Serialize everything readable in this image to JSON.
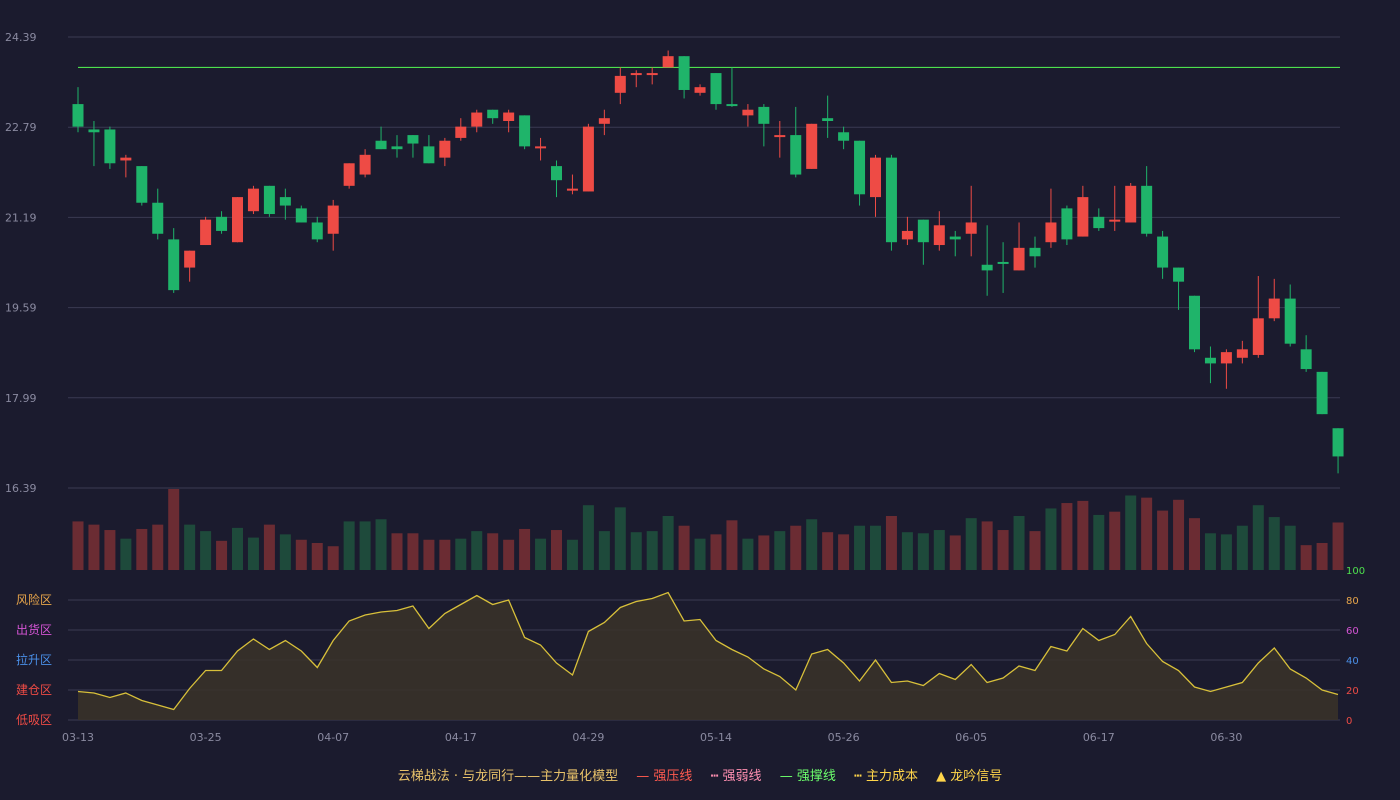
{
  "colors": {
    "background": "#1b1b2e",
    "grid": "#3b3b52",
    "axis_text": "#8a8aa0",
    "up": "#ee4b45",
    "down": "#1fb46a",
    "vol_up": "#6b2c33",
    "vol_down": "#1e4a3b",
    "resistance": "#4de04d",
    "indicator_line": "#d8c03a",
    "indicator_fill": "#3a3328",
    "zone_risk": "#e8a54a",
    "zone_sell": "#d454d4",
    "zone_rise": "#4a8fe8",
    "zone_build": "#ee4b45",
    "zone_low": "#ee4b45",
    "tick_80": "#e8a54a",
    "tick_60": "#d454d4",
    "tick_40": "#4a8fe8",
    "tick_20": "#ee4b45",
    "tick_0": "#ee4b45",
    "tick_100": "#4de04d"
  },
  "legend": {
    "title": "云梯战法 · 与龙同行——主力量化模型",
    "items": [
      {
        "symbol": "—",
        "label": "强压线"
      },
      {
        "symbol": "┅",
        "label": "强弱线"
      },
      {
        "symbol": "—",
        "label": "强撑线"
      },
      {
        "symbol": "┅",
        "label": "主力成本"
      },
      {
        "symbol": "▲",
        "label": "龙吟信号"
      }
    ]
  },
  "chart_data": [
    {
      "type": "candlestick",
      "y_ticks": [
        "24.39",
        "22.79",
        "21.19",
        "19.59",
        "17.99",
        "16.39"
      ],
      "ylim": [
        16.39,
        24.39
      ],
      "x_tick_labels": [
        {
          "index": 0,
          "label": "03-13"
        },
        {
          "index": 8,
          "label": "03-25"
        },
        {
          "index": 16,
          "label": "04-07"
        },
        {
          "index": 24,
          "label": "04-17"
        },
        {
          "index": 32,
          "label": "04-29"
        },
        {
          "index": 40,
          "label": "05-14"
        },
        {
          "index": 48,
          "label": "05-26"
        },
        {
          "index": 56,
          "label": "06-05"
        },
        {
          "index": 64,
          "label": "06-17"
        },
        {
          "index": 72,
          "label": "06-30"
        }
      ],
      "resistance_level": 23.85,
      "candles": [
        {
          "o": 22.8,
          "c": 23.2,
          "h": 23.5,
          "l": 22.7,
          "dir": "down"
        },
        {
          "o": 22.75,
          "c": 22.7,
          "h": 22.9,
          "l": 22.1,
          "dir": "down"
        },
        {
          "o": 22.75,
          "c": 22.15,
          "h": 22.8,
          "l": 22.05,
          "dir": "down"
        },
        {
          "o": 22.2,
          "c": 22.25,
          "h": 22.3,
          "l": 21.9,
          "dir": "up"
        },
        {
          "o": 22.1,
          "c": 21.45,
          "h": 22.1,
          "l": 21.4,
          "dir": "down"
        },
        {
          "o": 21.45,
          "c": 20.9,
          "h": 21.7,
          "l": 20.8,
          "dir": "down"
        },
        {
          "o": 20.8,
          "c": 19.9,
          "h": 21.0,
          "l": 19.85,
          "dir": "down"
        },
        {
          "o": 20.3,
          "c": 20.6,
          "h": 20.6,
          "l": 20.05,
          "dir": "up"
        },
        {
          "o": 20.7,
          "c": 21.15,
          "h": 21.2,
          "l": 20.7,
          "dir": "up"
        },
        {
          "o": 21.2,
          "c": 20.95,
          "h": 21.3,
          "l": 20.9,
          "dir": "down"
        },
        {
          "o": 20.75,
          "c": 21.55,
          "h": 21.55,
          "l": 20.75,
          "dir": "up"
        },
        {
          "o": 21.3,
          "c": 21.7,
          "h": 21.75,
          "l": 21.25,
          "dir": "up"
        },
        {
          "o": 21.75,
          "c": 21.25,
          "h": 21.75,
          "l": 21.2,
          "dir": "down"
        },
        {
          "o": 21.55,
          "c": 21.4,
          "h": 21.7,
          "l": 21.15,
          "dir": "down"
        },
        {
          "o": 21.35,
          "c": 21.1,
          "h": 21.4,
          "l": 21.1,
          "dir": "down"
        },
        {
          "o": 21.1,
          "c": 20.8,
          "h": 21.2,
          "l": 20.75,
          "dir": "down"
        },
        {
          "o": 20.9,
          "c": 21.4,
          "h": 21.5,
          "l": 20.6,
          "dir": "up"
        },
        {
          "o": 21.75,
          "c": 22.15,
          "h": 22.15,
          "l": 21.7,
          "dir": "up"
        },
        {
          "o": 21.95,
          "c": 22.3,
          "h": 22.4,
          "l": 21.9,
          "dir": "up"
        },
        {
          "o": 22.55,
          "c": 22.4,
          "h": 22.8,
          "l": 22.4,
          "dir": "down"
        },
        {
          "o": 22.45,
          "c": 22.4,
          "h": 22.65,
          "l": 22.25,
          "dir": "down"
        },
        {
          "o": 22.65,
          "c": 22.5,
          "h": 22.65,
          "l": 22.25,
          "dir": "down"
        },
        {
          "o": 22.45,
          "c": 22.15,
          "h": 22.65,
          "l": 22.15,
          "dir": "down"
        },
        {
          "o": 22.25,
          "c": 22.55,
          "h": 22.6,
          "l": 22.1,
          "dir": "up"
        },
        {
          "o": 22.6,
          "c": 22.8,
          "h": 22.95,
          "l": 22.55,
          "dir": "up"
        },
        {
          "o": 22.8,
          "c": 23.05,
          "h": 23.1,
          "l": 22.7,
          "dir": "up"
        },
        {
          "o": 23.1,
          "c": 22.95,
          "h": 23.1,
          "l": 22.85,
          "dir": "down"
        },
        {
          "o": 22.9,
          "c": 23.05,
          "h": 23.1,
          "l": 22.7,
          "dir": "up"
        },
        {
          "o": 23.0,
          "c": 22.45,
          "h": 23.0,
          "l": 22.4,
          "dir": "down"
        },
        {
          "o": 22.45,
          "c": 22.45,
          "h": 22.6,
          "l": 22.2,
          "dir": "up"
        },
        {
          "o": 22.1,
          "c": 21.85,
          "h": 22.2,
          "l": 21.55,
          "dir": "down"
        },
        {
          "o": 21.7,
          "c": 21.7,
          "h": 21.95,
          "l": 21.6,
          "dir": "up"
        },
        {
          "o": 21.65,
          "c": 22.8,
          "h": 22.85,
          "l": 21.65,
          "dir": "up"
        },
        {
          "o": 22.85,
          "c": 22.95,
          "h": 23.1,
          "l": 22.65,
          "dir": "up"
        },
        {
          "o": 23.4,
          "c": 23.7,
          "h": 23.85,
          "l": 23.2,
          "dir": "up"
        },
        {
          "o": 23.75,
          "c": 23.75,
          "h": 23.8,
          "l": 23.5,
          "dir": "up"
        },
        {
          "o": 23.75,
          "c": 23.75,
          "h": 23.85,
          "l": 23.55,
          "dir": "up"
        },
        {
          "o": 23.85,
          "c": 24.05,
          "h": 24.15,
          "l": 23.85,
          "dir": "up"
        },
        {
          "o": 24.05,
          "c": 23.45,
          "h": 24.05,
          "l": 23.3,
          "dir": "down"
        },
        {
          "o": 23.4,
          "c": 23.5,
          "h": 23.55,
          "l": 23.35,
          "dir": "up"
        },
        {
          "o": 23.75,
          "c": 23.2,
          "h": 23.75,
          "l": 23.1,
          "dir": "down"
        },
        {
          "o": 23.2,
          "c": 23.2,
          "h": 23.85,
          "l": 23.15,
          "dir": "down"
        },
        {
          "o": 23.0,
          "c": 23.1,
          "h": 23.2,
          "l": 22.8,
          "dir": "up"
        },
        {
          "o": 23.15,
          "c": 22.85,
          "h": 23.2,
          "l": 22.45,
          "dir": "down"
        },
        {
          "o": 22.65,
          "c": 22.65,
          "h": 22.9,
          "l": 22.25,
          "dir": "up"
        },
        {
          "o": 22.65,
          "c": 21.95,
          "h": 23.15,
          "l": 21.9,
          "dir": "down"
        },
        {
          "o": 22.05,
          "c": 22.85,
          "h": 22.85,
          "l": 22.05,
          "dir": "up"
        },
        {
          "o": 22.95,
          "c": 22.9,
          "h": 23.35,
          "l": 22.6,
          "dir": "down"
        },
        {
          "o": 22.7,
          "c": 22.55,
          "h": 22.8,
          "l": 22.4,
          "dir": "down"
        },
        {
          "o": 22.55,
          "c": 21.6,
          "h": 22.55,
          "l": 21.4,
          "dir": "down"
        },
        {
          "o": 21.55,
          "c": 22.25,
          "h": 22.3,
          "l": 21.2,
          "dir": "up"
        },
        {
          "o": 22.25,
          "c": 20.75,
          "h": 22.3,
          "l": 20.6,
          "dir": "down"
        },
        {
          "o": 20.8,
          "c": 20.95,
          "h": 21.2,
          "l": 20.7,
          "dir": "up"
        },
        {
          "o": 21.15,
          "c": 20.75,
          "h": 21.15,
          "l": 20.35,
          "dir": "down"
        },
        {
          "o": 20.7,
          "c": 21.05,
          "h": 21.3,
          "l": 20.6,
          "dir": "up"
        },
        {
          "o": 20.85,
          "c": 20.8,
          "h": 20.95,
          "l": 20.5,
          "dir": "down"
        },
        {
          "o": 20.9,
          "c": 21.1,
          "h": 21.75,
          "l": 20.5,
          "dir": "up"
        },
        {
          "o": 20.35,
          "c": 20.25,
          "h": 21.05,
          "l": 19.8,
          "dir": "down"
        },
        {
          "o": 20.4,
          "c": 20.4,
          "h": 20.75,
          "l": 19.85,
          "dir": "down"
        },
        {
          "o": 20.25,
          "c": 20.65,
          "h": 21.1,
          "l": 20.25,
          "dir": "up"
        },
        {
          "o": 20.65,
          "c": 20.5,
          "h": 20.85,
          "l": 20.3,
          "dir": "down"
        },
        {
          "o": 20.75,
          "c": 21.1,
          "h": 21.7,
          "l": 20.65,
          "dir": "up"
        },
        {
          "o": 21.35,
          "c": 20.8,
          "h": 21.4,
          "l": 20.7,
          "dir": "down"
        },
        {
          "o": 20.85,
          "c": 21.55,
          "h": 21.75,
          "l": 20.85,
          "dir": "up"
        },
        {
          "o": 21.2,
          "c": 21.0,
          "h": 21.35,
          "l": 20.95,
          "dir": "down"
        },
        {
          "o": 21.15,
          "c": 21.15,
          "h": 21.75,
          "l": 20.95,
          "dir": "up"
        },
        {
          "o": 21.1,
          "c": 21.75,
          "h": 21.8,
          "l": 21.1,
          "dir": "up"
        },
        {
          "o": 21.75,
          "c": 20.9,
          "h": 22.1,
          "l": 20.85,
          "dir": "down"
        },
        {
          "o": 20.85,
          "c": 20.3,
          "h": 20.95,
          "l": 20.1,
          "dir": "down"
        },
        {
          "o": 20.3,
          "c": 20.05,
          "h": 20.3,
          "l": 19.55,
          "dir": "down"
        },
        {
          "o": 19.8,
          "c": 18.85,
          "h": 19.8,
          "l": 18.8,
          "dir": "down"
        },
        {
          "o": 18.7,
          "c": 18.6,
          "h": 18.9,
          "l": 18.25,
          "dir": "down"
        },
        {
          "o": 18.6,
          "c": 18.8,
          "h": 18.85,
          "l": 18.15,
          "dir": "up"
        },
        {
          "o": 18.7,
          "c": 18.85,
          "h": 19.0,
          "l": 18.6,
          "dir": "up"
        },
        {
          "o": 18.75,
          "c": 19.4,
          "h": 20.15,
          "l": 18.7,
          "dir": "up"
        },
        {
          "o": 19.4,
          "c": 19.75,
          "h": 20.1,
          "l": 19.35,
          "dir": "up"
        },
        {
          "o": 19.75,
          "c": 18.95,
          "h": 20.0,
          "l": 18.9,
          "dir": "down"
        },
        {
          "o": 18.85,
          "c": 18.5,
          "h": 19.1,
          "l": 18.45,
          "dir": "down"
        },
        {
          "o": 18.45,
          "c": 17.7,
          "h": 18.45,
          "l": 17.7,
          "dir": "down"
        },
        {
          "o": 17.45,
          "c": 16.95,
          "h": 17.45,
          "l": 16.65,
          "dir": "down"
        }
      ]
    },
    {
      "type": "bar",
      "title": "",
      "values": [
        45,
        42,
        37,
        29,
        38,
        42,
        75,
        42,
        36,
        27,
        39,
        30,
        42,
        33,
        28,
        25,
        22,
        45,
        45,
        47,
        34,
        34,
        28,
        28,
        29,
        36,
        34,
        28,
        38,
        29,
        37,
        28,
        60,
        36,
        58,
        35,
        36,
        50,
        41,
        29,
        33,
        46,
        29,
        32,
        36,
        41,
        47,
        35,
        33,
        41,
        41,
        50,
        35,
        34,
        37,
        32,
        48,
        45,
        37,
        50,
        36,
        57,
        62,
        64,
        51,
        54,
        69,
        67,
        55,
        65,
        48,
        34,
        33,
        41,
        60,
        49,
        41,
        23,
        25,
        44
      ],
      "colors": [
        "up",
        "up",
        "up",
        "down",
        "up",
        "up",
        "up",
        "down",
        "down",
        "up",
        "down",
        "down",
        "up",
        "down",
        "up",
        "up",
        "up",
        "down",
        "down",
        "down",
        "up",
        "up",
        "up",
        "up",
        "down",
        "down",
        "up",
        "up",
        "up",
        "down",
        "up",
        "down",
        "down",
        "down",
        "down",
        "down",
        "down",
        "down",
        "up",
        "down",
        "up",
        "up",
        "down",
        "up",
        "down",
        "up",
        "down",
        "up",
        "up",
        "down",
        "down",
        "up",
        "down",
        "down",
        "down",
        "up",
        "down",
        "up",
        "up",
        "down",
        "up",
        "down",
        "up",
        "up",
        "down",
        "up",
        "down",
        "up",
        "up",
        "up",
        "up",
        "down",
        "down",
        "down",
        "down",
        "down",
        "down",
        "up",
        "up",
        "up"
      ]
    },
    {
      "type": "area",
      "yticks": [
        "100",
        "80",
        "60",
        "40",
        "20",
        "0"
      ],
      "ylim": [
        0,
        100
      ],
      "zones": [
        "风险区",
        "出货区",
        "拉升区",
        "建仓区",
        "低吸区"
      ],
      "values": [
        19,
        18,
        15,
        18,
        13,
        10,
        7,
        21,
        33,
        33,
        46,
        54,
        47,
        53,
        46,
        35,
        53,
        66,
        70,
        72,
        73,
        76,
        61,
        71,
        77,
        83,
        77,
        80,
        55,
        50,
        38,
        30,
        59,
        65,
        75,
        79,
        81,
        85,
        66,
        67,
        53,
        47,
        42,
        34,
        29,
        20,
        44,
        47,
        38,
        26,
        40,
        25,
        26,
        23,
        31,
        27,
        37,
        25,
        28,
        36,
        33,
        49,
        46,
        61,
        53,
        57,
        69,
        51,
        39,
        33,
        22,
        19,
        22,
        25,
        38,
        48,
        34,
        28,
        20,
        17
      ]
    }
  ]
}
